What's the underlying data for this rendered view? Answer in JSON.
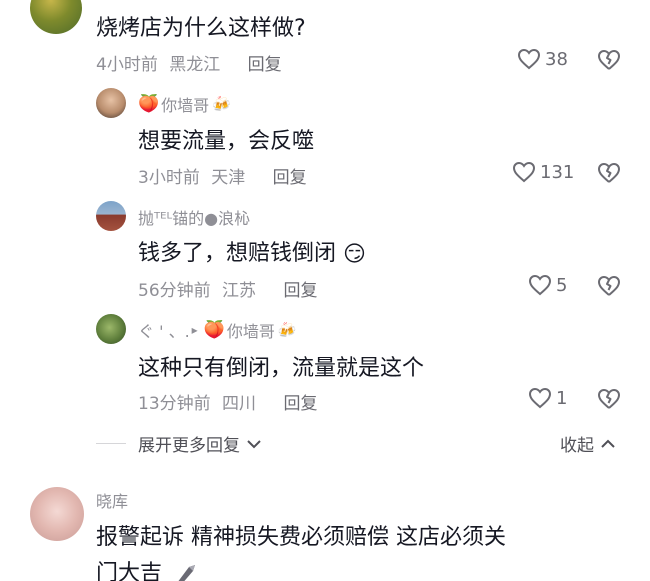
{
  "top_comment": {
    "text": "烧烤店为什么这样做?",
    "time": "4小时前",
    "location": "黑龙江",
    "reply_label": "回复",
    "likes": "38"
  },
  "replies": [
    {
      "author": "你墙哥",
      "author_prefix_icon": "peach-emoji",
      "author_suffix_icon": "beer-emoji",
      "text": "想要流量，会反噬",
      "time": "3小时前",
      "location": "天津",
      "reply_label": "回复",
      "likes": "131"
    },
    {
      "author": "抛ᵀᴱᴸ锚的●浪杺",
      "text": "钱多了，想赔钱倒闭",
      "emoji": "😏",
      "time": "56分钟前",
      "location": "江苏",
      "reply_label": "回复",
      "likes": "5"
    },
    {
      "author_reply_from": "ぐ ' 、. ",
      "reply_arrow": "▸",
      "author": "你墙哥",
      "text": "这种只有倒闭，流量就是这个",
      "time": "13分钟前",
      "location": "四川",
      "reply_label": "回复",
      "likes": "1"
    }
  ],
  "thread_controls": {
    "expand_label": "展开更多回复",
    "collapse_label": "收起"
  },
  "next_comment": {
    "author": "晓库",
    "text_line1": "报警起诉 精神损失费必须赔偿 这店必须关",
    "text_line2": "门大吉",
    "trailing_icon": "knife-icon"
  },
  "colors": {
    "text": "#161823",
    "meta": "#8f8f96",
    "divider": "#d6d6d9"
  }
}
